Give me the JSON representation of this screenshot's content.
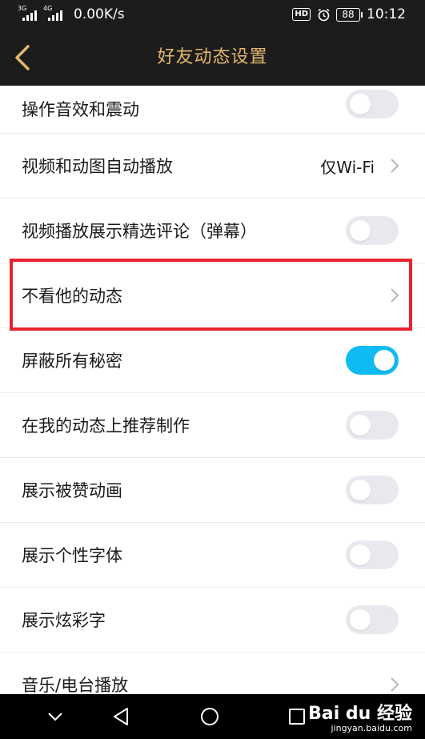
{
  "status_bar": {
    "signal1_label": "3G",
    "signal2_label": "4G",
    "speed": "0.00K/s",
    "hd": "HD",
    "battery": "88",
    "time": "10:12"
  },
  "header": {
    "title": "好友动态设置"
  },
  "settings": [
    {
      "label": "操作音效和震动",
      "type": "toggle",
      "on": false
    },
    {
      "label": "视频和动图自动播放",
      "type": "select",
      "value": "仅Wi-Fi"
    },
    {
      "label": "视频播放展示精选评论（弹幕）",
      "type": "toggle",
      "on": false
    },
    {
      "label": "不看他的动态",
      "type": "link"
    },
    {
      "label": "屏蔽所有秘密",
      "type": "toggle",
      "on": true
    },
    {
      "label": "在我的动态上推荐制作",
      "type": "toggle",
      "on": false
    },
    {
      "label": "展示被赞动画",
      "type": "toggle",
      "on": false
    },
    {
      "label": "展示个性字体",
      "type": "toggle",
      "on": false
    },
    {
      "label": "展示炫彩字",
      "type": "toggle",
      "on": false
    },
    {
      "label": "音乐/电台播放",
      "type": "link"
    }
  ],
  "watermark": {
    "logo": "Bai du 经验",
    "url": "jingyan.baidu.com"
  },
  "colors": {
    "header_bg": "#1c1c1c",
    "title": "#e3b66e",
    "toggle_on": "#0ebbf2",
    "toggle_off": "#e8e9ee",
    "highlight": "#e8232d"
  }
}
